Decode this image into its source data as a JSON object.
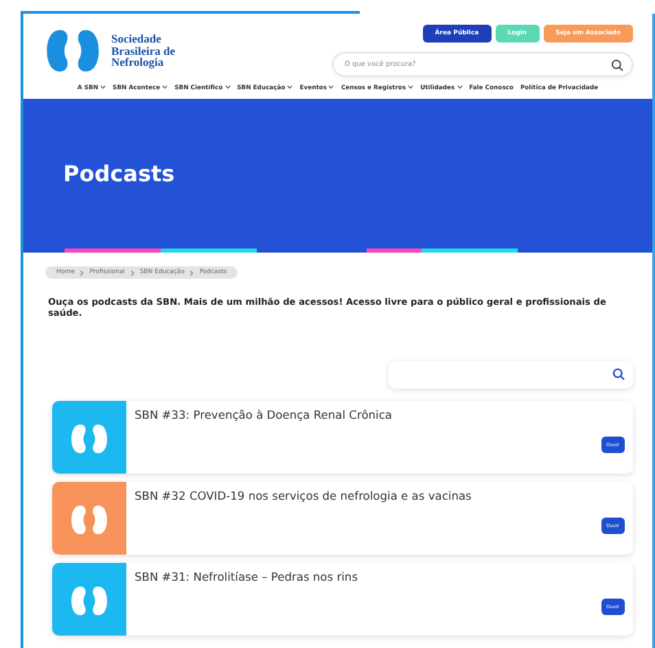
{
  "logo": {
    "lines": [
      "Sociedade",
      "Brasileira de",
      "Nefrologia"
    ]
  },
  "top_buttons": [
    {
      "label": "Área Pública",
      "kind": "public"
    },
    {
      "label": "Login",
      "kind": "login"
    },
    {
      "label": "Seja um Associado",
      "kind": "join"
    }
  ],
  "search": {
    "placeholder": "O que você procura?"
  },
  "nav": [
    {
      "label": "A SBN",
      "dropdown": true
    },
    {
      "label": "SBN Acontece",
      "dropdown": true
    },
    {
      "label": "SBN Científico",
      "dropdown": true
    },
    {
      "label": "SBN Educação",
      "dropdown": true
    },
    {
      "label": "Eventos",
      "dropdown": true
    },
    {
      "label": "Censos e Registros",
      "dropdown": true
    },
    {
      "label": "Utilidades",
      "dropdown": true
    },
    {
      "label": "Fale Conosco",
      "dropdown": false
    },
    {
      "label": "Política de Privacidade",
      "dropdown": false
    }
  ],
  "banner": {
    "title": "Podcasts"
  },
  "breadcrumb": [
    "Home",
    "Profissional",
    "SBN Educação",
    "Podcasts"
  ],
  "intro": "Ouça os podcasts da SBN. Mais de um milhão de acessos! Acesso livre para o público geral e profissionais de saúde.",
  "podcasts": [
    {
      "title": "SBN #33: Prevenção à Doença Renal Crônica",
      "color": "#1cb8f0",
      "button": "Ouvir"
    },
    {
      "title": "SBN #32 COVID-19 nos serviços de nefrologia e as vacinas",
      "color": "#f7935a",
      "button": "Ouvir"
    },
    {
      "title": "SBN #31: Nefrolitíase – Pedras nos rins",
      "color": "#1cb8f0",
      "button": "Ouvir"
    }
  ]
}
